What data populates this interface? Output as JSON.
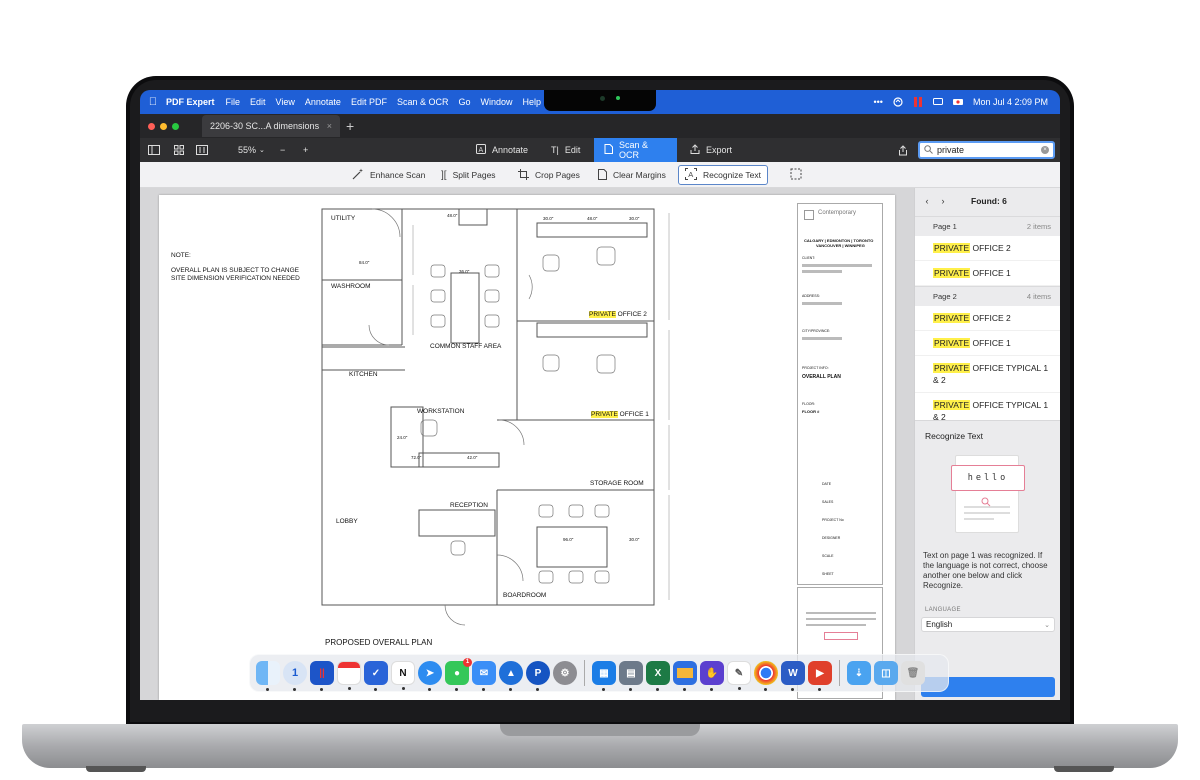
{
  "menubar": {
    "app_name": "PDF Expert",
    "items": [
      "File",
      "Edit",
      "View",
      "Annotate",
      "Edit PDF",
      "Scan & OCR",
      "Go",
      "Window",
      "Help"
    ],
    "more": "•••",
    "datetime": "Mon Jul 4  2:09 PM"
  },
  "tab": {
    "title": "2206-30 SC...A dimensions",
    "close": "×",
    "new": "+"
  },
  "toolbar": {
    "zoom": "55%",
    "zoom_out": "−",
    "zoom_in": "+",
    "modes": [
      "Annotate",
      "Edit",
      "Scan & OCR",
      "Export"
    ],
    "active_mode": "Scan & OCR"
  },
  "search": {
    "value": "private",
    "placeholder": "Search"
  },
  "ocr_toolbar": {
    "items": [
      "Enhance Scan",
      "Split Pages",
      "Crop Pages",
      "Clear Margins",
      "Recognize Text"
    ],
    "active": "Recognize Text"
  },
  "results": {
    "found_label": "Found: 6",
    "pages": [
      {
        "label": "Page 1",
        "count": "2 items",
        "items": [
          {
            "match": "PRIVATE",
            "rest": " OFFICE 2"
          },
          {
            "match": "PRIVATE",
            "rest": " OFFICE 1"
          }
        ]
      },
      {
        "label": "Page 2",
        "count": "4 items",
        "items": [
          {
            "match": "PRIVATE",
            "rest": " OFFICE 2"
          },
          {
            "match": "PRIVATE",
            "rest": " OFFICE 1"
          },
          {
            "match": "PRIVATE",
            "rest": " OFFICE TYPICAL 1 & 2"
          },
          {
            "match": "PRIVATE",
            "rest": " OFFICE TYPICAL 1 & 2"
          }
        ]
      }
    ]
  },
  "recognize": {
    "title": "Recognize Text",
    "sample": "hello",
    "description": "Text on page 1 was recognized. If the language is not correct, choose another one below and click Recognize.",
    "language_label": "LANGUAGE",
    "language": "English"
  },
  "floorplan": {
    "note_title": "NOTE:",
    "note_line1": "OVERALL PLAN IS SUBJECT TO CHANGE",
    "note_line2": "SITE DIMENSION VERIFICATION NEEDED",
    "rooms": {
      "utility": "UTILITY",
      "washroom": "WASHROOM",
      "kitchen": "KITCHEN",
      "workstation": "WORKSTATION",
      "staff": "COMMON STAFF AREA",
      "reception": "RECEPTION",
      "lobby": "LOBBY",
      "storage": "STORAGE ROOM",
      "boardroom": "BOARDROOM",
      "office2_match": "PRIVATE",
      "office2_rest": " OFFICE 2",
      "office1_match": "PRIVATE",
      "office1_rest": " OFFICE 1"
    },
    "dims": [
      "48.0\"",
      "30.0\"",
      "48.0\"",
      "30.0\"",
      "84.0\"",
      "36.0\"",
      "72.0\"",
      "42.0\"",
      "24.0\"",
      "72.0\"",
      "42.0\"",
      "56.0\"",
      "96.0\"",
      "30.0\"",
      "120.0\"",
      "108.0\"",
      "72.0\""
    ],
    "plan_title": "PROPOSED OVERALL PLAN",
    "title_block": {
      "company": "Contemporary",
      "cities": "CALGARY | EDMONTON | TORONTO",
      "cities2": "VANCOUVER | WINNIPEG",
      "client": "CLIENT:",
      "address": "ADDRESS:",
      "city": "CITY/PROVINCE:",
      "project_info": "PROJECT INFO:",
      "project": "OVERALL PLAN",
      "floor_label": "FLOOR:",
      "floor": "FLOOR #",
      "date": "DATE",
      "sales": "SALES",
      "project_no": "PROJECT No",
      "designer": "DESIGNER",
      "scale": "SCALE",
      "sheet": "SHEET"
    }
  },
  "colors": {
    "accent": "#2e80ee",
    "menubar": "#1f5fd6",
    "highlight": "#fff04a"
  },
  "dock": [
    "Finder",
    "1Password",
    "Parallels",
    "Fantastical",
    "OmniFocus",
    "Notion",
    "Safari",
    "Messages",
    "Mail",
    "iStat Menus",
    "Pockity",
    "Settings",
    "Windows",
    "Scanner",
    "Excel",
    "Keynote",
    "Stocks",
    "Sketchbook",
    "Chrome",
    "Word",
    "Reeder",
    "Downloads",
    "Folder",
    "Trash"
  ],
  "messages_badge": "1"
}
